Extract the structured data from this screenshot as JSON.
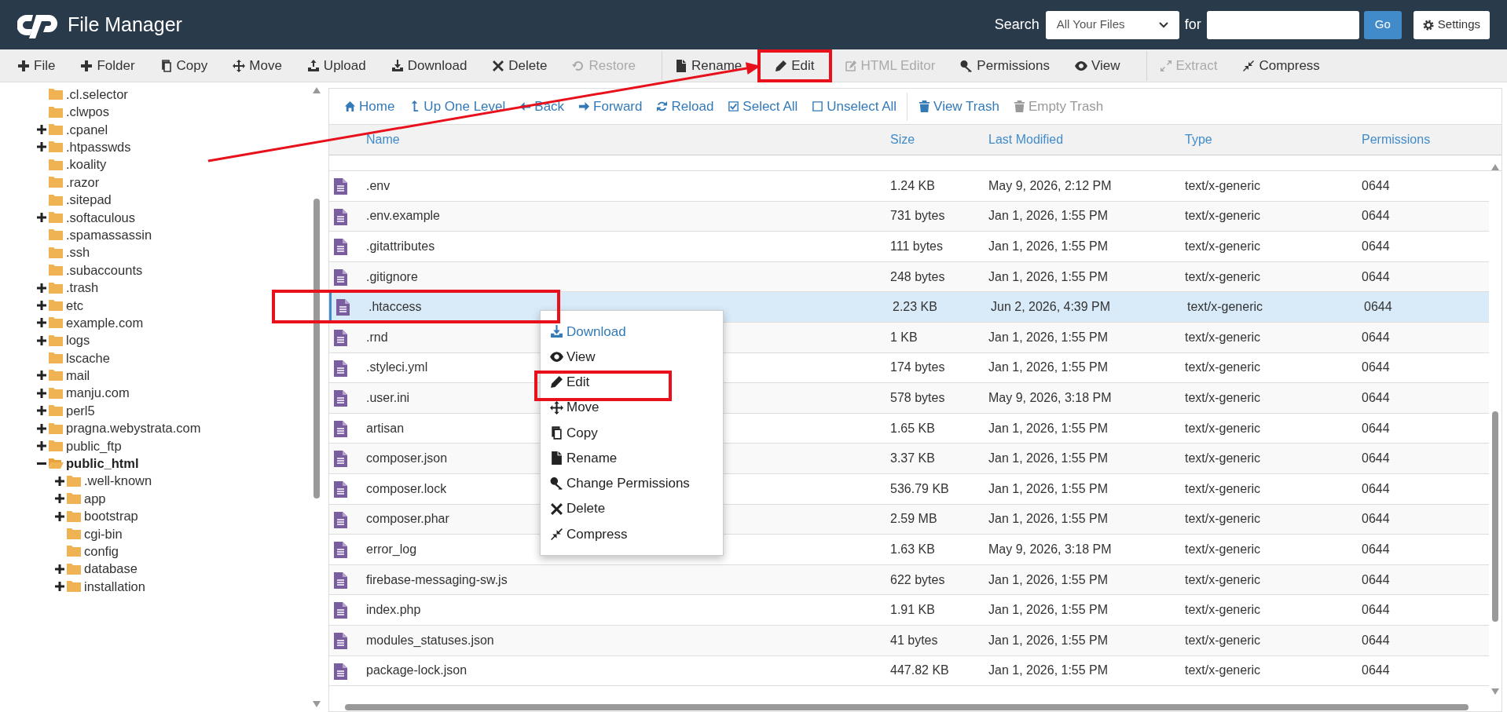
{
  "window": {
    "title": "File Manager"
  },
  "search": {
    "label": "Search",
    "scope": "All Your Files",
    "for_label": "for",
    "button": "Go"
  },
  "settings_button": "Settings",
  "toolbar": {
    "items": [
      {
        "label": "File",
        "disabled": false,
        "highlighted": false,
        "separator_before": false
      },
      {
        "label": "Folder",
        "disabled": false,
        "highlighted": false,
        "separator_before": false
      },
      {
        "label": "Copy",
        "disabled": false,
        "highlighted": false,
        "separator_before": false
      },
      {
        "label": "Move",
        "disabled": false,
        "highlighted": false,
        "separator_before": false
      },
      {
        "label": "Upload",
        "disabled": false,
        "highlighted": false,
        "separator_before": false
      },
      {
        "label": "Download",
        "disabled": false,
        "highlighted": false,
        "separator_before": false
      },
      {
        "label": "Delete",
        "disabled": false,
        "highlighted": false,
        "separator_before": false
      },
      {
        "label": "Restore",
        "disabled": true,
        "highlighted": false,
        "separator_before": false
      },
      {
        "label": "Rename",
        "disabled": false,
        "highlighted": false,
        "separator_before": true
      },
      {
        "label": "Edit",
        "disabled": false,
        "highlighted": true,
        "separator_before": false
      },
      {
        "label": "HTML Editor",
        "disabled": true,
        "highlighted": false,
        "separator_before": false
      },
      {
        "label": "Permissions",
        "disabled": false,
        "highlighted": false,
        "separator_before": false
      },
      {
        "label": "View",
        "disabled": false,
        "highlighted": false,
        "separator_before": false
      },
      {
        "label": "Extract",
        "disabled": true,
        "highlighted": false,
        "separator_before": true
      },
      {
        "label": "Compress",
        "disabled": false,
        "highlighted": false,
        "separator_before": false
      }
    ]
  },
  "annotation_arrow": true,
  "sidebar": {
    "tree": [
      {
        "label": ".cl.selector",
        "expandable": false,
        "expanded": false,
        "selected": false
      },
      {
        "label": ".clwpos",
        "expandable": false,
        "expanded": false,
        "selected": false
      },
      {
        "label": ".cpanel",
        "expandable": true,
        "expanded": false,
        "selected": false
      },
      {
        "label": ".htpasswds",
        "expandable": true,
        "expanded": false,
        "selected": false
      },
      {
        "label": ".koality",
        "expandable": false,
        "expanded": false,
        "selected": false
      },
      {
        "label": ".razor",
        "expandable": false,
        "expanded": false,
        "selected": false
      },
      {
        "label": ".sitepad",
        "expandable": false,
        "expanded": false,
        "selected": false
      },
      {
        "label": ".softaculous",
        "expandable": true,
        "expanded": false,
        "selected": false
      },
      {
        "label": ".spamassassin",
        "expandable": false,
        "expanded": false,
        "selected": false
      },
      {
        "label": ".ssh",
        "expandable": false,
        "expanded": false,
        "selected": false
      },
      {
        "label": ".subaccounts",
        "expandable": false,
        "expanded": false,
        "selected": false
      },
      {
        "label": ".trash",
        "expandable": true,
        "expanded": false,
        "selected": false
      },
      {
        "label": "etc",
        "expandable": true,
        "expanded": false,
        "selected": false
      },
      {
        "label": "example.com",
        "expandable": true,
        "expanded": false,
        "selected": false
      },
      {
        "label": "logs",
        "expandable": true,
        "expanded": false,
        "selected": false
      },
      {
        "label": "lscache",
        "expandable": false,
        "expanded": false,
        "selected": false
      },
      {
        "label": "mail",
        "expandable": true,
        "expanded": false,
        "selected": false
      },
      {
        "label": "manju.com",
        "expandable": true,
        "expanded": false,
        "selected": false
      },
      {
        "label": "perl5",
        "expandable": true,
        "expanded": false,
        "selected": false
      },
      {
        "label": "pragna.webystrata.com",
        "expandable": true,
        "expanded": false,
        "selected": false
      },
      {
        "label": "public_ftp",
        "expandable": true,
        "expanded": false,
        "selected": false
      },
      {
        "label": "public_html",
        "expandable": true,
        "expanded": true,
        "selected": true,
        "children": [
          {
            "label": ".well-known",
            "expandable": true,
            "expanded": false,
            "selected": false
          },
          {
            "label": "app",
            "expandable": true,
            "expanded": false,
            "selected": false
          },
          {
            "label": "bootstrap",
            "expandable": true,
            "expanded": false,
            "selected": false
          },
          {
            "label": "cgi-bin",
            "expandable": false,
            "expanded": false,
            "selected": false
          },
          {
            "label": "config",
            "expandable": false,
            "expanded": false,
            "selected": false
          },
          {
            "label": "database",
            "expandable": true,
            "expanded": false,
            "selected": false
          },
          {
            "label": "installation",
            "expandable": true,
            "expanded": false,
            "selected": false
          }
        ]
      }
    ]
  },
  "nav": {
    "items": [
      {
        "label": "Home",
        "disabled": false,
        "separator_before": false
      },
      {
        "label": "Up One Level",
        "disabled": false,
        "separator_before": false
      },
      {
        "label": "Back",
        "disabled": false,
        "separator_before": false
      },
      {
        "label": "Forward",
        "disabled": false,
        "separator_before": false
      },
      {
        "label": "Reload",
        "disabled": false,
        "separator_before": false
      },
      {
        "label": "Select All",
        "disabled": false,
        "separator_before": false
      },
      {
        "label": "Unselect All",
        "disabled": false,
        "separator_before": false
      },
      {
        "label": "View Trash",
        "disabled": false,
        "separator_before": true
      },
      {
        "label": "Empty Trash",
        "disabled": true,
        "separator_before": false
      }
    ]
  },
  "table": {
    "columns": [
      "Name",
      "Size",
      "Last Modified",
      "Type",
      "Permissions"
    ],
    "rows": [
      {
        "name": ".env",
        "size": "1.24 KB",
        "modified": "May 9, 2026, 2:12 PM",
        "type": "text/x-generic",
        "permissions": "0644",
        "selected": false,
        "highlighted": false
      },
      {
        "name": ".env.example",
        "size": "731 bytes",
        "modified": "Jan 1, 2026, 1:55 PM",
        "type": "text/x-generic",
        "permissions": "0644",
        "selected": false,
        "highlighted": false
      },
      {
        "name": ".gitattributes",
        "size": "111 bytes",
        "modified": "Jan 1, 2026, 1:55 PM",
        "type": "text/x-generic",
        "permissions": "0644",
        "selected": false,
        "highlighted": false
      },
      {
        "name": ".gitignore",
        "size": "248 bytes",
        "modified": "Jan 1, 2026, 1:55 PM",
        "type": "text/x-generic",
        "permissions": "0644",
        "selected": false,
        "highlighted": false
      },
      {
        "name": ".htaccess",
        "size": "2.23 KB",
        "modified": "Jun 2, 2026, 4:39 PM",
        "type": "text/x-generic",
        "permissions": "0644",
        "selected": true,
        "highlighted": true
      },
      {
        "name": ".rnd",
        "size": "1 KB",
        "modified": "Jan 1, 2026, 1:55 PM",
        "type": "text/x-generic",
        "permissions": "0644",
        "selected": false,
        "highlighted": false
      },
      {
        "name": ".styleci.yml",
        "size": "174 bytes",
        "modified": "Jan 1, 2026, 1:55 PM",
        "type": "text/x-generic",
        "permissions": "0644",
        "selected": false,
        "highlighted": false
      },
      {
        "name": ".user.ini",
        "size": "578 bytes",
        "modified": "May 9, 2026, 3:18 PM",
        "type": "text/x-generic",
        "permissions": "0644",
        "selected": false,
        "highlighted": false
      },
      {
        "name": "artisan",
        "size": "1.65 KB",
        "modified": "Jan 1, 2026, 1:55 PM",
        "type": "text/x-generic",
        "permissions": "0644",
        "selected": false,
        "highlighted": false
      },
      {
        "name": "composer.json",
        "size": "3.37 KB",
        "modified": "Jan 1, 2026, 1:55 PM",
        "type": "text/x-generic",
        "permissions": "0644",
        "selected": false,
        "highlighted": false
      },
      {
        "name": "composer.lock",
        "size": "536.79 KB",
        "modified": "Jan 1, 2026, 1:55 PM",
        "type": "text/x-generic",
        "permissions": "0644",
        "selected": false,
        "highlighted": false
      },
      {
        "name": "composer.phar",
        "size": "2.59 MB",
        "modified": "Jan 1, 2026, 1:55 PM",
        "type": "text/x-generic",
        "permissions": "0644",
        "selected": false,
        "highlighted": false
      },
      {
        "name": "error_log",
        "size": "1.63 KB",
        "modified": "May 9, 2026, 3:18 PM",
        "type": "text/x-generic",
        "permissions": "0644",
        "selected": false,
        "highlighted": false
      },
      {
        "name": "firebase-messaging-sw.js",
        "size": "622 bytes",
        "modified": "Jan 1, 2026, 1:55 PM",
        "type": "text/x-generic",
        "permissions": "0644",
        "selected": false,
        "highlighted": false
      },
      {
        "name": "index.php",
        "size": "1.91 KB",
        "modified": "Jan 1, 2026, 1:55 PM",
        "type": "text/x-generic",
        "permissions": "0644",
        "selected": false,
        "highlighted": false
      },
      {
        "name": "modules_statuses.json",
        "size": "41 bytes",
        "modified": "Jan 1, 2026, 1:55 PM",
        "type": "text/x-generic",
        "permissions": "0644",
        "selected": false,
        "highlighted": false
      },
      {
        "name": "package-lock.json",
        "size": "447.82 KB",
        "modified": "Jan 1, 2026, 1:55 PM",
        "type": "text/x-generic",
        "permissions": "0644",
        "selected": false,
        "highlighted": false
      }
    ]
  },
  "context_menu": {
    "items": [
      {
        "label": "Download",
        "active": true,
        "highlighted": false
      },
      {
        "label": "View",
        "active": false,
        "highlighted": false
      },
      {
        "label": "Edit",
        "active": false,
        "highlighted": true
      },
      {
        "label": "Move",
        "active": false,
        "highlighted": false
      },
      {
        "label": "Copy",
        "active": false,
        "highlighted": false
      },
      {
        "label": "Rename",
        "active": false,
        "highlighted": false
      },
      {
        "label": "Change Permissions",
        "active": false,
        "highlighted": false
      },
      {
        "label": "Delete",
        "active": false,
        "highlighted": false
      },
      {
        "label": "Compress",
        "active": false,
        "highlighted": false
      }
    ]
  }
}
